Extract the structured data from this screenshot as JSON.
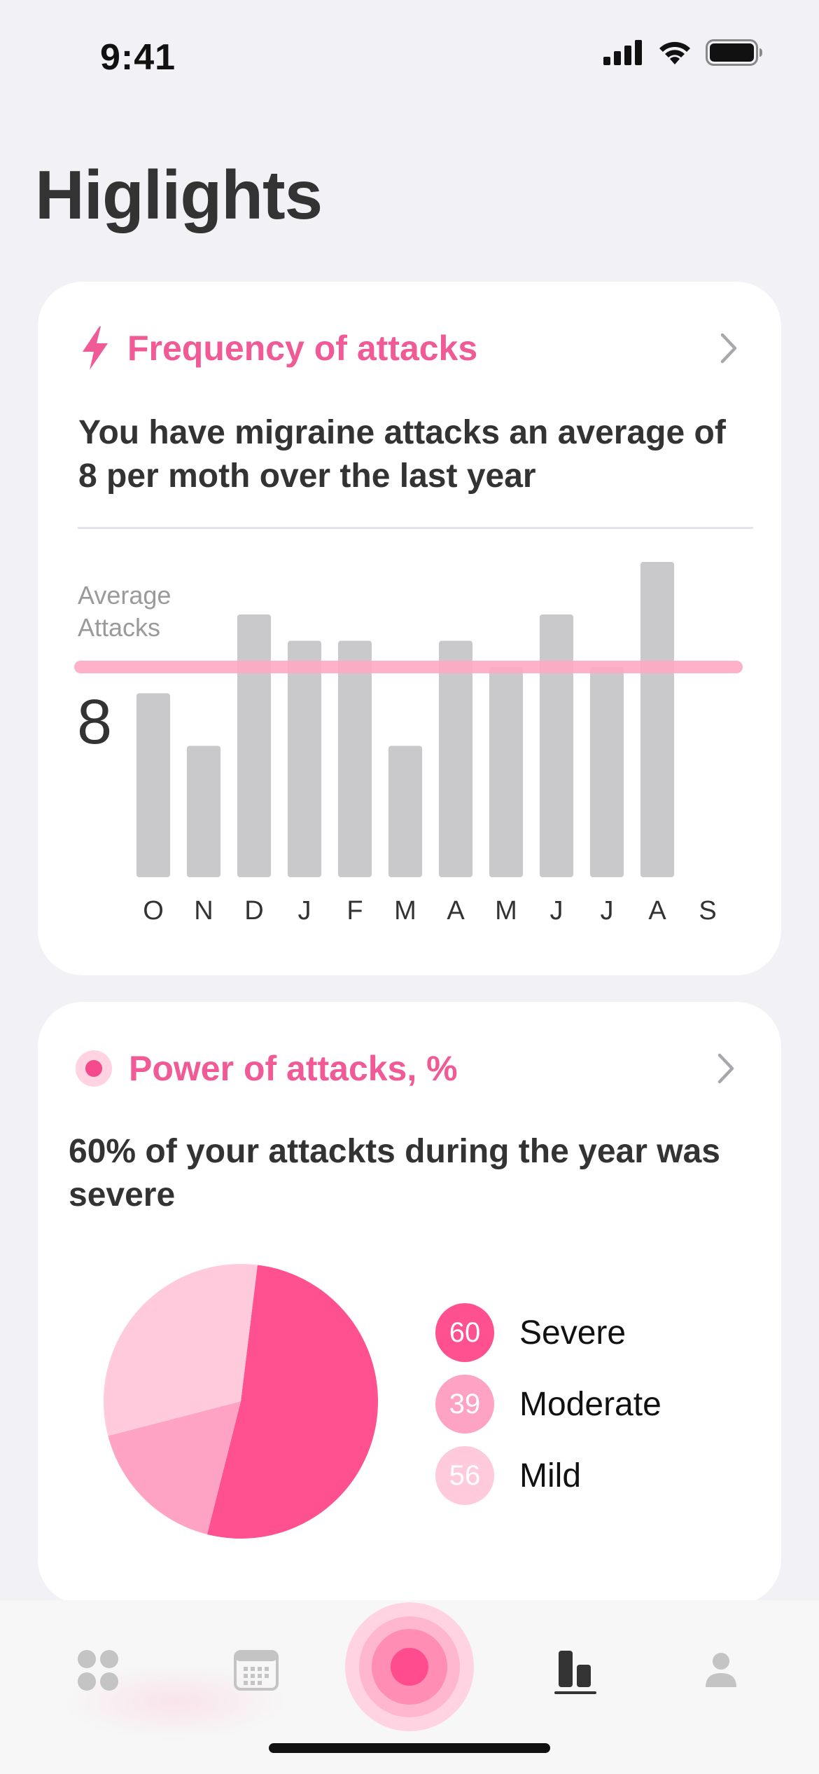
{
  "status_bar": {
    "time": "9:41"
  },
  "page_title": "Higlights",
  "colors": {
    "accent": "#F05A96",
    "bar": "#C9C9CB",
    "avg_line": "#FFA9C4",
    "severe": "#FF5190",
    "moderate": "#FFA3C4",
    "mild": "#FFCBDC"
  },
  "frequency_card": {
    "title": "Frequency of attacks",
    "icon": "lightning-icon",
    "summary": "You have migraine attacks an average of 8 per moth over the last year",
    "avg_label": "Average Attacks",
    "avg_value": "8",
    "chart_data": {
      "type": "bar",
      "categories": [
        "O",
        "N",
        "D",
        "J",
        "F",
        "M",
        "A",
        "M",
        "J",
        "J",
        "A",
        "S"
      ],
      "values": [
        7,
        5,
        10,
        9,
        9,
        5,
        9,
        8,
        10,
        8,
        12,
        null
      ],
      "average": 8,
      "ylim": [
        0,
        12
      ]
    }
  },
  "power_card": {
    "title": "Power of attacks, %",
    "icon": "dot-icon",
    "summary": "60% of your attackts during the year was severe",
    "chart_data": {
      "type": "pie",
      "slices": [
        {
          "label": "Severe",
          "value": 60,
          "fraction": 0.52
        },
        {
          "label": "Moderate",
          "value": 39,
          "fraction": 0.17
        },
        {
          "label": "Mild",
          "value": 56,
          "fraction": 0.31
        }
      ]
    },
    "legend": [
      {
        "value": "60",
        "label": "Severe"
      },
      {
        "value": "39",
        "label": "Moderate"
      },
      {
        "value": "56",
        "label": "Mild"
      }
    ]
  },
  "tab_bar": {
    "tabs": [
      {
        "name": "dashboard",
        "icon": "grid-icon"
      },
      {
        "name": "calendar",
        "icon": "calendar-icon"
      },
      {
        "name": "record",
        "icon": "record-attack-icon"
      },
      {
        "name": "statistics",
        "icon": "bar-chart-icon",
        "active": true
      },
      {
        "name": "profile",
        "icon": "person-icon"
      }
    ]
  }
}
